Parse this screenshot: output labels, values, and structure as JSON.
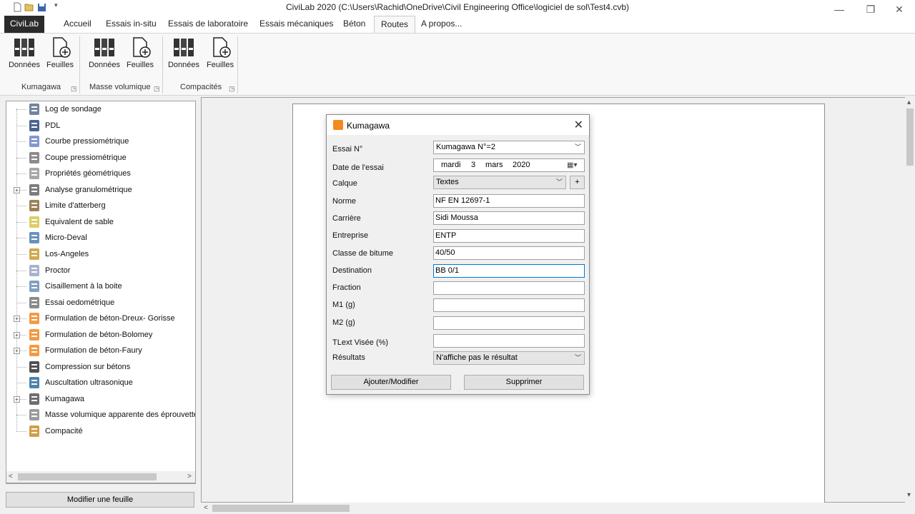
{
  "window": {
    "title": "CiviLab 2020 (C:\\Users\\Rachid\\OneDrive\\Civil Engineering Office\\logiciel de sol\\Test4.cvb)"
  },
  "tabs": {
    "file": "CiviLab",
    "items": [
      "Accueil",
      "Essais in-situ",
      "Essais de laboratoire",
      "Essais mécaniques",
      "Béton",
      "Routes",
      "A propos..."
    ],
    "active": "Routes"
  },
  "ribbon": {
    "groups": [
      {
        "label": "Kumagawa",
        "buttons": [
          "Données",
          "Feuilles"
        ]
      },
      {
        "label": "Masse volumique",
        "buttons": [
          "Données",
          "Feuilles"
        ]
      },
      {
        "label": "Compacités",
        "buttons": [
          "Données",
          "Feuilles"
        ]
      }
    ]
  },
  "tree": {
    "items": [
      {
        "label": "Log de sondage",
        "icon": "log-icon",
        "expandable": false
      },
      {
        "label": "PDL",
        "icon": "pdl-icon",
        "expandable": false
      },
      {
        "label": "Courbe pressiométrique",
        "icon": "gauge-icon",
        "expandable": false
      },
      {
        "label": "Coupe pressiométrique",
        "icon": "probe-icon",
        "expandable": false
      },
      {
        "label": "Propriétés géométriques",
        "icon": "flask-icon",
        "expandable": false
      },
      {
        "label": "Analyse granulométrique",
        "icon": "sieve-icon",
        "expandable": true
      },
      {
        "label": "Limite d'atterberg",
        "icon": "atterberg-icon",
        "expandable": false
      },
      {
        "label": "Equivalent de sable",
        "icon": "sand-icon",
        "expandable": false
      },
      {
        "label": "Micro-Deval",
        "icon": "micro-deval-icon",
        "expandable": false
      },
      {
        "label": "Los-Angeles",
        "icon": "los-angeles-icon",
        "expandable": false
      },
      {
        "label": "Proctor",
        "icon": "proctor-icon",
        "expandable": false
      },
      {
        "label": "Cisaillement à la boite",
        "icon": "shear-box-icon",
        "expandable": false
      },
      {
        "label": "Essai oedométrique",
        "icon": "oedometer-icon",
        "expandable": false
      },
      {
        "label": "Formulation de béton-Dreux- Gorisse",
        "icon": "concrete-truck-icon",
        "expandable": true
      },
      {
        "label": "Formulation de béton-Bolomey",
        "icon": "concrete-truck-icon",
        "expandable": true
      },
      {
        "label": "Formulation de béton-Faury",
        "icon": "concrete-truck-icon",
        "expandable": true
      },
      {
        "label": "Compression sur bétons",
        "icon": "compression-icon",
        "expandable": false
      },
      {
        "label": "Auscultation ultrasonique",
        "icon": "ultrasonic-icon",
        "expandable": false
      },
      {
        "label": "Kumagawa",
        "icon": "kumagawa-icon",
        "expandable": true
      },
      {
        "label": "Masse volumique apparente des éprouvettes bi",
        "icon": "density-icon",
        "expandable": false
      },
      {
        "label": "Compacité",
        "icon": "compaction-icon",
        "expandable": false
      }
    ]
  },
  "left_footer": {
    "modify_button": "Modifier une feuille"
  },
  "dialog": {
    "title": "Kumagawa",
    "fields": {
      "essai": {
        "label": "Essai N°",
        "value": "Kumagawa N°=2"
      },
      "date": {
        "label": "Date de l'essai",
        "day_name": "mardi",
        "day": "3",
        "month": "mars",
        "year": "2020"
      },
      "calque": {
        "label": "Calque",
        "value": "Textes",
        "add": "+"
      },
      "norme": {
        "label": "Norme",
        "value": "NF EN 12697-1"
      },
      "carriere": {
        "label": "Carrière",
        "value": "Sidi Moussa"
      },
      "entreprise": {
        "label": "Entreprise",
        "value": "ENTP"
      },
      "classe": {
        "label": "Classe de bitume",
        "value": "40/50"
      },
      "destination": {
        "label": "Destination",
        "value": "BB 0/1"
      },
      "fraction": {
        "label": "Fraction",
        "value": ""
      },
      "m1": {
        "label": "M1 (g)",
        "value": ""
      },
      "m2": {
        "label": "M2 (g)",
        "value": ""
      },
      "tlext": {
        "label": "TLext Visée (%)",
        "value": ""
      },
      "resultats": {
        "label": "Résultats",
        "value": "N'affiche pas le résultat"
      }
    },
    "buttons": {
      "add_modify": "Ajouter/Modifier",
      "delete": "Supprimer"
    }
  }
}
